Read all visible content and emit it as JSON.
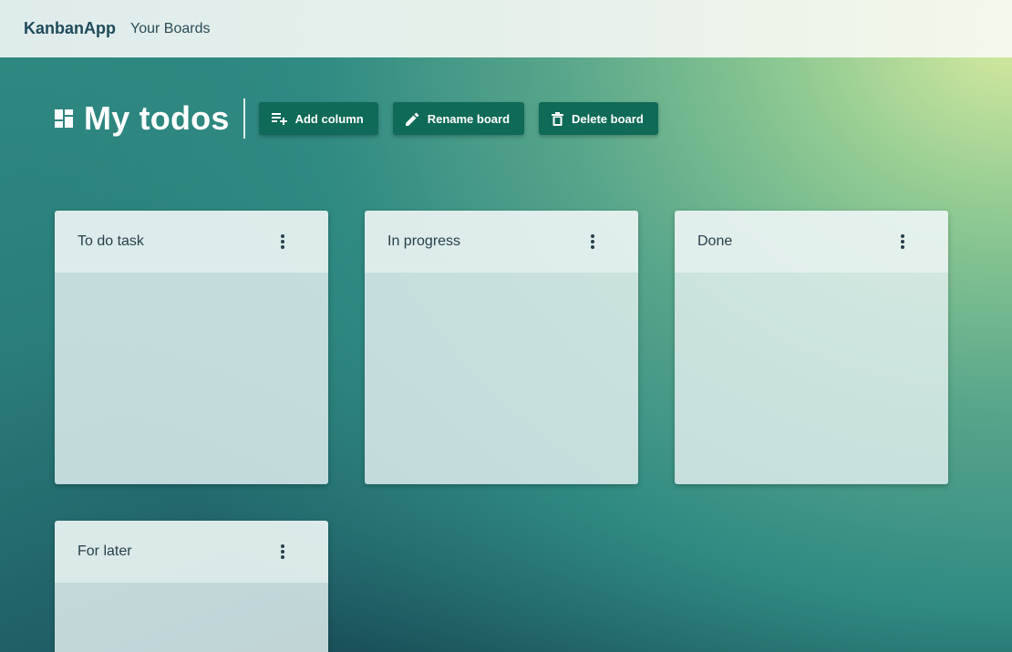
{
  "app": {
    "brand": "KanbanApp",
    "nav_link": "Your Boards"
  },
  "board": {
    "title": "My todos",
    "icon": "dashboard-icon",
    "actions": [
      {
        "label": "Add column",
        "icon": "playlist-add-icon"
      },
      {
        "label": "Rename board",
        "icon": "pencil-icon"
      },
      {
        "label": "Delete board",
        "icon": "trash-icon"
      }
    ]
  },
  "columns": [
    {
      "title": "To do task",
      "menu_icon": "more-vertical-icon",
      "cards": []
    },
    {
      "title": "In progress",
      "menu_icon": "more-vertical-icon",
      "cards": []
    },
    {
      "title": "Done",
      "menu_icon": "more-vertical-icon",
      "cards": []
    },
    {
      "title": "For later",
      "menu_icon": "more-vertical-icon",
      "cards": []
    }
  ],
  "colors": {
    "button_bg": "#0f6a58",
    "brand_text": "#1e4a5a",
    "title_text": "#ffffff"
  }
}
